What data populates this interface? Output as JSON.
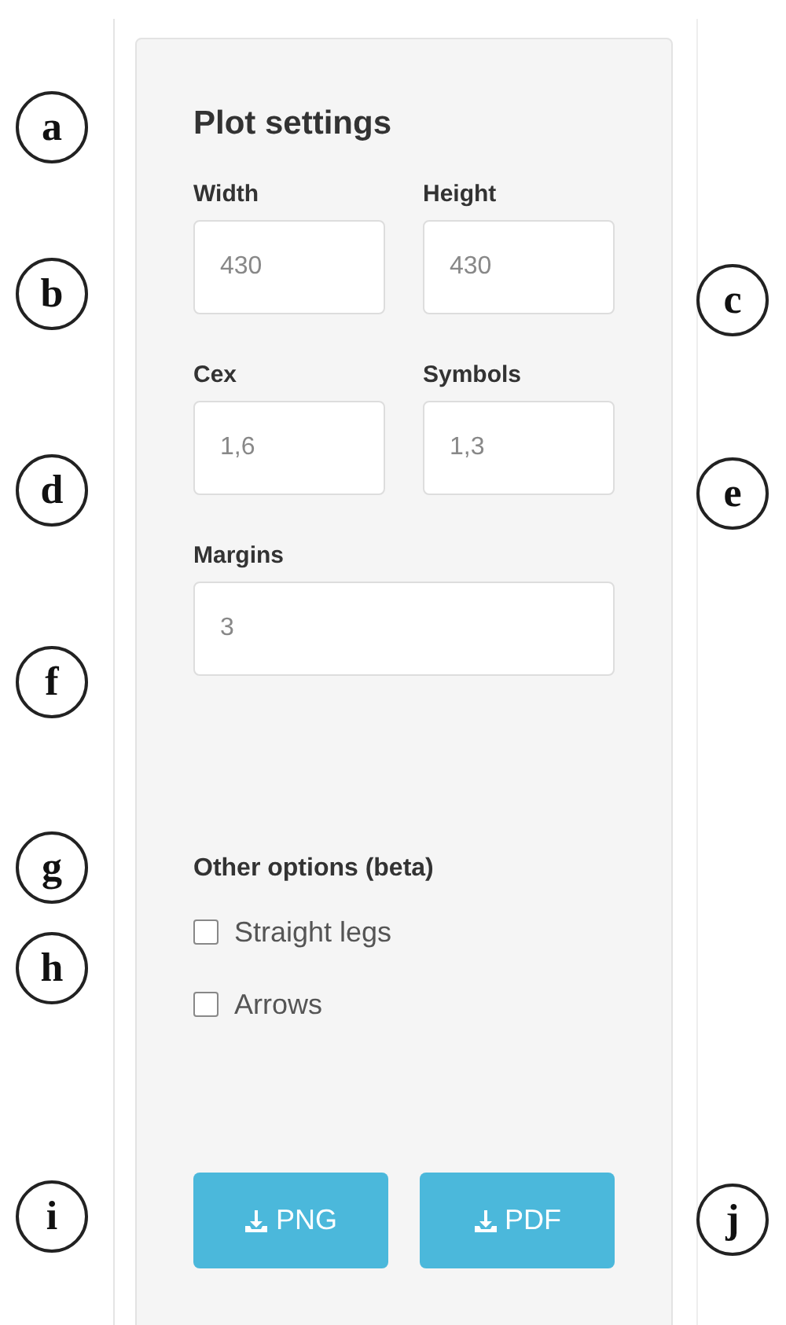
{
  "callouts": [
    {
      "label": "a",
      "kind": "left"
    },
    {
      "label": "b",
      "kind": "left"
    },
    {
      "label": "c",
      "kind": "right"
    },
    {
      "label": "d",
      "kind": "left"
    },
    {
      "label": "e",
      "kind": "right"
    },
    {
      "label": "f",
      "kind": "left"
    },
    {
      "label": "g",
      "kind": "left"
    },
    {
      "label": "h",
      "kind": "left"
    },
    {
      "label": "i",
      "kind": "left"
    },
    {
      "label": "j",
      "kind": "right"
    }
  ],
  "panel": {
    "title": "Plot settings",
    "field_rows": [
      [
        {
          "label": "Width",
          "value": "430"
        },
        {
          "label": "Height",
          "value": "430"
        }
      ],
      [
        {
          "label": "Cex",
          "value": "1,6"
        },
        {
          "label": "Symbols",
          "value": "1,3"
        }
      ],
      [
        {
          "label": "Margins",
          "value": "3"
        }
      ]
    ],
    "section_title": "Other options (beta)",
    "options": [
      {
        "label": "Straight legs",
        "checked": false
      },
      {
        "label": "Arrows",
        "checked": false
      }
    ],
    "buttons": [
      {
        "label": "PNG"
      },
      {
        "label": "PDF"
      }
    ]
  }
}
